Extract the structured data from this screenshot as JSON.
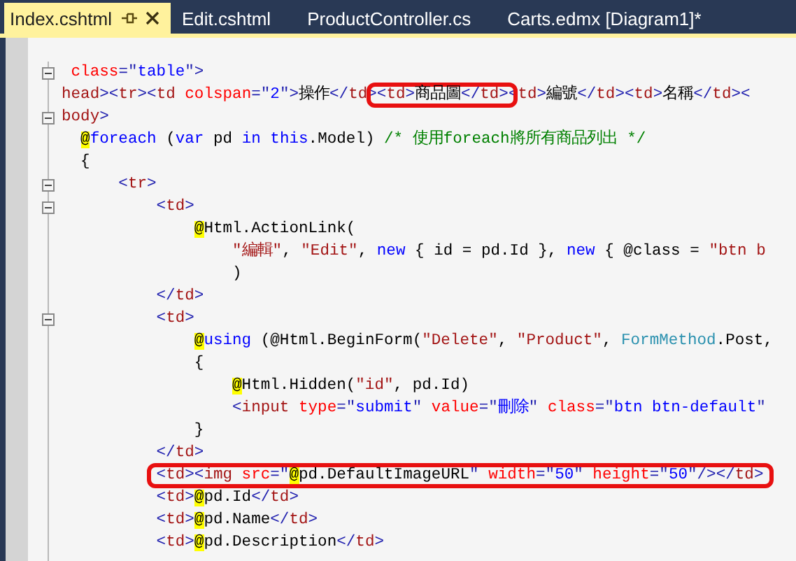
{
  "tabs": [
    {
      "label": "Index.cshtml",
      "selected": true,
      "pinnable": true,
      "closable": true
    },
    {
      "label": "Edit.cshtml",
      "selected": false
    },
    {
      "label": "ProductController.cs",
      "selected": false
    },
    {
      "label": "Carts.edmx [Diagram1]*",
      "selected": false
    }
  ],
  "editor": {
    "lines": [
      {
        "fold": true,
        "segments": [
          {
            "kind": "attr",
            "text": " class"
          },
          {
            "kind": "punct",
            "text": "=\""
          },
          {
            "kind": "value",
            "text": "table"
          },
          {
            "kind": "punct",
            "text": "\">"
          }
        ]
      },
      {
        "segments": [
          {
            "kind": "tag",
            "text": "head"
          },
          {
            "kind": "punct",
            "text": "><"
          },
          {
            "kind": "tag",
            "text": "tr"
          },
          {
            "kind": "punct",
            "text": "><"
          },
          {
            "kind": "tag",
            "text": "td"
          },
          {
            "kind": "attr",
            "text": " colspan"
          },
          {
            "kind": "punct",
            "text": "=\""
          },
          {
            "kind": "value",
            "text": "2"
          },
          {
            "kind": "punct",
            "text": "\">"
          },
          {
            "kind": "text",
            "text": "操作"
          },
          {
            "kind": "punct",
            "text": "</"
          },
          {
            "kind": "tag",
            "text": "td"
          },
          {
            "kind": "punct",
            "text": ">"
          },
          {
            "kind": "group",
            "boxed": true,
            "segments": [
              {
                "kind": "punct",
                "text": "<"
              },
              {
                "kind": "tag",
                "text": "td"
              },
              {
                "kind": "punct",
                "text": ">"
              },
              {
                "kind": "text",
                "text": "商品圖"
              },
              {
                "kind": "punct",
                "text": "</"
              },
              {
                "kind": "tag",
                "text": "td"
              },
              {
                "kind": "punct",
                "text": ">"
              }
            ]
          },
          {
            "kind": "punct",
            "text": "<"
          },
          {
            "kind": "tag",
            "text": "td"
          },
          {
            "kind": "punct",
            "text": ">"
          },
          {
            "kind": "text",
            "text": "編號"
          },
          {
            "kind": "punct",
            "text": "</"
          },
          {
            "kind": "tag",
            "text": "td"
          },
          {
            "kind": "punct",
            "text": "><"
          },
          {
            "kind": "tag",
            "text": "td"
          },
          {
            "kind": "punct",
            "text": ">"
          },
          {
            "kind": "text",
            "text": "名稱"
          },
          {
            "kind": "punct",
            "text": "</"
          },
          {
            "kind": "tag",
            "text": "td"
          },
          {
            "kind": "punct",
            "text": "><"
          }
        ]
      },
      {
        "fold": true,
        "segments": [
          {
            "kind": "tag",
            "text": "body"
          },
          {
            "kind": "punct",
            "text": ">"
          }
        ],
        "children": [
          {
            "segments": [
              {
                "kind": "razor",
                "text": "@"
              },
              {
                "kind": "keyword",
                "text": "foreach"
              },
              {
                "kind": "text",
                "text": " ("
              },
              {
                "kind": "keyword",
                "text": "var"
              },
              {
                "kind": "text",
                "text": " pd "
              },
              {
                "kind": "keyword",
                "text": "in"
              },
              {
                "kind": "keyword",
                "text": " this"
              },
              {
                "kind": "text",
                "text": ".Model) "
              },
              {
                "kind": "comment",
                "text": "/* 使用foreach將所有商品列出 */"
              }
            ]
          },
          {
            "segments": [
              {
                "kind": "text",
                "text": "{"
              }
            ],
            "children": [
              {
                "fold": true,
                "segments": [
                  {
                    "kind": "punct",
                    "text": "<"
                  },
                  {
                    "kind": "tag",
                    "text": "tr"
                  },
                  {
                    "kind": "punct",
                    "text": ">"
                  }
                ],
                "children": [
                  {
                    "fold": true,
                    "segments": [
                      {
                        "kind": "punct",
                        "text": "<"
                      },
                      {
                        "kind": "tag",
                        "text": "td"
                      },
                      {
                        "kind": "punct",
                        "text": ">"
                      }
                    ],
                    "children": [
                      {
                        "segments": [
                          {
                            "kind": "razor",
                            "text": "@"
                          },
                          {
                            "kind": "text",
                            "text": "Html.ActionLink("
                          }
                        ],
                        "children": [
                          {
                            "segments": [
                              {
                                "kind": "string",
                                "text": "\"編輯\""
                              },
                              {
                                "kind": "text",
                                "text": ", "
                              },
                              {
                                "kind": "string",
                                "text": "\"Edit\""
                              },
                              {
                                "kind": "text",
                                "text": ", "
                              },
                              {
                                "kind": "keyword",
                                "text": "new"
                              },
                              {
                                "kind": "text",
                                "text": " { id = pd.Id }, "
                              },
                              {
                                "kind": "keyword",
                                "text": "new"
                              },
                              {
                                "kind": "text",
                                "text": " { @class = "
                              },
                              {
                                "kind": "string",
                                "text": "\"btn b"
                              }
                            ]
                          },
                          {
                            "segments": [
                              {
                                "kind": "text",
                                "text": ")"
                              }
                            ]
                          }
                        ]
                      }
                    ]
                  },
                  {
                    "segments": [
                      {
                        "kind": "punct",
                        "text": "</"
                      },
                      {
                        "kind": "tag",
                        "text": "td"
                      },
                      {
                        "kind": "punct",
                        "text": ">"
                      }
                    ]
                  },
                  {
                    "fold": true,
                    "segments": [
                      {
                        "kind": "punct",
                        "text": "<"
                      },
                      {
                        "kind": "tag",
                        "text": "td"
                      },
                      {
                        "kind": "punct",
                        "text": ">"
                      }
                    ],
                    "children": [
                      {
                        "segments": [
                          {
                            "kind": "razor",
                            "text": "@"
                          },
                          {
                            "kind": "keyword",
                            "text": "using"
                          },
                          {
                            "kind": "text",
                            "text": " (@Html.BeginForm("
                          },
                          {
                            "kind": "string",
                            "text": "\"Delete\""
                          },
                          {
                            "kind": "text",
                            "text": ", "
                          },
                          {
                            "kind": "string",
                            "text": "\"Product\""
                          },
                          {
                            "kind": "text",
                            "text": ", "
                          },
                          {
                            "kind": "type",
                            "text": "FormMethod"
                          },
                          {
                            "kind": "text",
                            "text": ".Post,"
                          }
                        ]
                      },
                      {
                        "segments": [
                          {
                            "kind": "text",
                            "text": "{"
                          }
                        ],
                        "children": [
                          {
                            "segments": [
                              {
                                "kind": "razor",
                                "text": "@"
                              },
                              {
                                "kind": "text",
                                "text": "Html.Hidden("
                              },
                              {
                                "kind": "string",
                                "text": "\"id\""
                              },
                              {
                                "kind": "text",
                                "text": ", pd.Id)"
                              }
                            ]
                          },
                          {
                            "segments": [
                              {
                                "kind": "punct",
                                "text": "<"
                              },
                              {
                                "kind": "tag",
                                "text": "input"
                              },
                              {
                                "kind": "attr",
                                "text": " type"
                              },
                              {
                                "kind": "punct",
                                "text": "=\""
                              },
                              {
                                "kind": "value",
                                "text": "submit"
                              },
                              {
                                "kind": "punct",
                                "text": "\""
                              },
                              {
                                "kind": "attr",
                                "text": " value"
                              },
                              {
                                "kind": "punct",
                                "text": "=\""
                              },
                              {
                                "kind": "value",
                                "text": "刪除"
                              },
                              {
                                "kind": "punct",
                                "text": "\""
                              },
                              {
                                "kind": "attr",
                                "text": " class"
                              },
                              {
                                "kind": "punct",
                                "text": "=\""
                              },
                              {
                                "kind": "value",
                                "text": "btn btn-default"
                              },
                              {
                                "kind": "punct",
                                "text": "\""
                              }
                            ]
                          }
                        ]
                      },
                      {
                        "segments": [
                          {
                            "kind": "text",
                            "text": "}"
                          }
                        ]
                      }
                    ]
                  },
                  {
                    "segments": [
                      {
                        "kind": "punct",
                        "text": "</"
                      },
                      {
                        "kind": "tag",
                        "text": "td"
                      },
                      {
                        "kind": "punct",
                        "text": ">"
                      }
                    ]
                  },
                  {
                    "segments": [
                      {
                        "kind": "group",
                        "boxed": true,
                        "segments": [
                          {
                            "kind": "punct",
                            "text": "<"
                          },
                          {
                            "kind": "tag",
                            "text": "td"
                          },
                          {
                            "kind": "punct",
                            "text": "><"
                          },
                          {
                            "kind": "tag",
                            "text": "img"
                          },
                          {
                            "kind": "attr",
                            "text": " src"
                          },
                          {
                            "kind": "punct",
                            "text": "=\""
                          },
                          {
                            "kind": "razor",
                            "text": "@"
                          },
                          {
                            "kind": "text",
                            "text": "pd.DefaultImageURL"
                          },
                          {
                            "kind": "punct",
                            "text": "\""
                          },
                          {
                            "kind": "attr",
                            "text": " width"
                          },
                          {
                            "kind": "punct",
                            "text": "=\""
                          },
                          {
                            "kind": "value",
                            "text": "50"
                          },
                          {
                            "kind": "punct",
                            "text": "\""
                          },
                          {
                            "kind": "attr",
                            "text": " height"
                          },
                          {
                            "kind": "punct",
                            "text": "=\""
                          },
                          {
                            "kind": "value",
                            "text": "50"
                          },
                          {
                            "kind": "punct",
                            "text": "\"/></"
                          },
                          {
                            "kind": "tag",
                            "text": "td"
                          },
                          {
                            "kind": "punct",
                            "text": ">"
                          }
                        ]
                      }
                    ]
                  },
                  {
                    "segments": [
                      {
                        "kind": "punct",
                        "text": "<"
                      },
                      {
                        "kind": "tag",
                        "text": "td"
                      },
                      {
                        "kind": "punct",
                        "text": ">"
                      },
                      {
                        "kind": "razor",
                        "text": "@"
                      },
                      {
                        "kind": "text",
                        "text": "pd.Id"
                      },
                      {
                        "kind": "punct",
                        "text": "</"
                      },
                      {
                        "kind": "tag",
                        "text": "td"
                      },
                      {
                        "kind": "punct",
                        "text": ">"
                      }
                    ]
                  },
                  {
                    "segments": [
                      {
                        "kind": "punct",
                        "text": "<"
                      },
                      {
                        "kind": "tag",
                        "text": "td"
                      },
                      {
                        "kind": "punct",
                        "text": ">"
                      },
                      {
                        "kind": "razor",
                        "text": "@"
                      },
                      {
                        "kind": "text",
                        "text": "pd.Name"
                      },
                      {
                        "kind": "punct",
                        "text": "</"
                      },
                      {
                        "kind": "tag",
                        "text": "td"
                      },
                      {
                        "kind": "punct",
                        "text": ">"
                      }
                    ]
                  },
                  {
                    "segments": [
                      {
                        "kind": "punct",
                        "text": "<"
                      },
                      {
                        "kind": "tag",
                        "text": "td"
                      },
                      {
                        "kind": "punct",
                        "text": ">"
                      },
                      {
                        "kind": "razor",
                        "text": "@"
                      },
                      {
                        "kind": "text",
                        "text": "pd.Description"
                      },
                      {
                        "kind": "punct",
                        "text": "</"
                      },
                      {
                        "kind": "tag",
                        "text": "td"
                      },
                      {
                        "kind": "punct",
                        "text": ">"
                      }
                    ]
                  }
                ]
              }
            ]
          }
        ]
      }
    ]
  }
}
